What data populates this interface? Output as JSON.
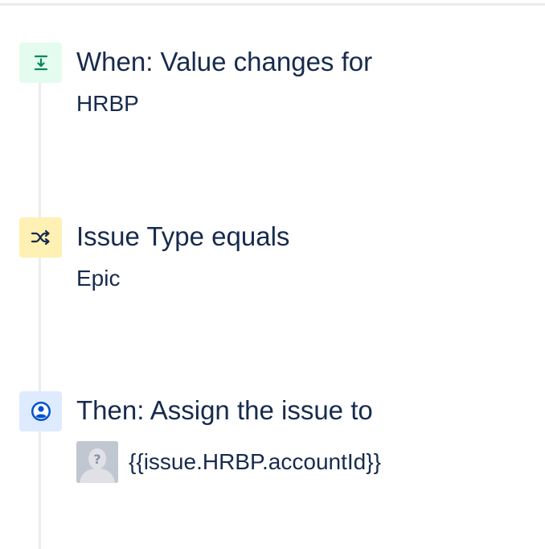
{
  "colors": {
    "trigger_bg": "#e3fcef",
    "trigger_icon": "#00875a",
    "condition_bg": "#fff0b3",
    "condition_icon": "#172b4d",
    "action_bg": "#deebff",
    "action_icon": "#0052cc",
    "text": "#172b4d"
  },
  "steps": [
    {
      "icon": "trigger-download-icon",
      "title": "When: Value changes for",
      "detail": "HRBP"
    },
    {
      "icon": "shuffle-branch-icon",
      "title": "Issue Type equals",
      "detail": "Epic"
    },
    {
      "icon": "user-assign-icon",
      "title": "Then: Assign the issue to",
      "assignee": {
        "avatar_icon": "unknown-user-avatar-icon",
        "value": "{{issue.HRBP.accountId}}"
      }
    }
  ]
}
